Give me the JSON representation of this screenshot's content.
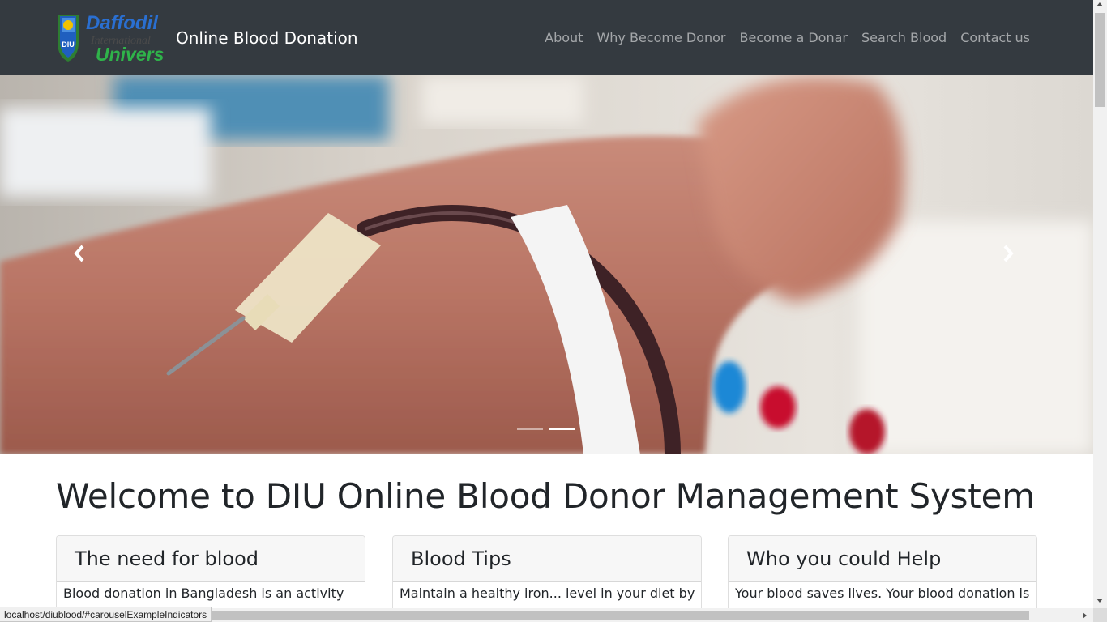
{
  "navbar": {
    "logo": {
      "line1": "Daffodil",
      "line2": "International",
      "line3": "University",
      "emblem_text": "DIU"
    },
    "brand": "Online Blood Donation",
    "links": [
      "About",
      "Why Become Donor",
      "Become a Donar",
      "Search Blood",
      "Contact us"
    ],
    "background": "#343a40",
    "link_color": "rgba(255,255,255,0.55)"
  },
  "carousel": {
    "slide_count": 2,
    "active_slide": 1,
    "image_icon": "blood-donation-photo"
  },
  "main": {
    "heading": "Welcome to DIU Online Blood Donor Management System",
    "cards": [
      {
        "title": "The need for blood",
        "body": "Blood donation in Bangladesh is an activity"
      },
      {
        "title": "Blood Tips",
        "body": "Maintain a healthy iron... level in your diet by"
      },
      {
        "title": "Who you could Help",
        "body": "Your blood saves lives. Your blood donation is"
      }
    ]
  },
  "status_bar": {
    "url": "localhost/diublood/#carouselExampleIndicators"
  }
}
